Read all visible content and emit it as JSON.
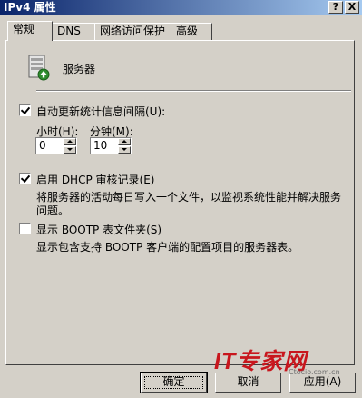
{
  "window": {
    "title": "IPv4 属性",
    "help_button": "?",
    "close_button": "X"
  },
  "tabs": [
    {
      "label": "常规",
      "active": true
    },
    {
      "label": "DNS"
    },
    {
      "label": "网络访问保护"
    },
    {
      "label": "高级"
    }
  ],
  "general": {
    "header_label": "服务器",
    "auto_update": {
      "label": "自动更新统计信息间隔(U):",
      "checked": true,
      "hours_label": "小时(H):",
      "hours_value": "0",
      "minutes_label": "分钟(M):",
      "minutes_value": "10"
    },
    "dhcp_audit": {
      "label": "启用 DHCP 审核记录(E)",
      "checked": true,
      "description_line1": "将服务器的活动每日写入一个文件，以监视系统性能并解决服务",
      "description_line2": "问题。"
    },
    "bootp": {
      "label": "显示 BOOTP 表文件夹(S)",
      "checked": false,
      "description": "显示包含支持 BOOTP 客户端的配置项目的服务器表。"
    }
  },
  "buttons": {
    "ok": "确定",
    "cancel": "取消",
    "apply": "应用(A)"
  },
  "watermark": {
    "logo": "IT专家网",
    "site": "Ctocio.com.cn"
  },
  "colors": {
    "titlebar_start": "#0a246a",
    "titlebar_end": "#a6caf0",
    "dialog_background": "#d4d0c8",
    "watermark_red": "#c8161d"
  }
}
